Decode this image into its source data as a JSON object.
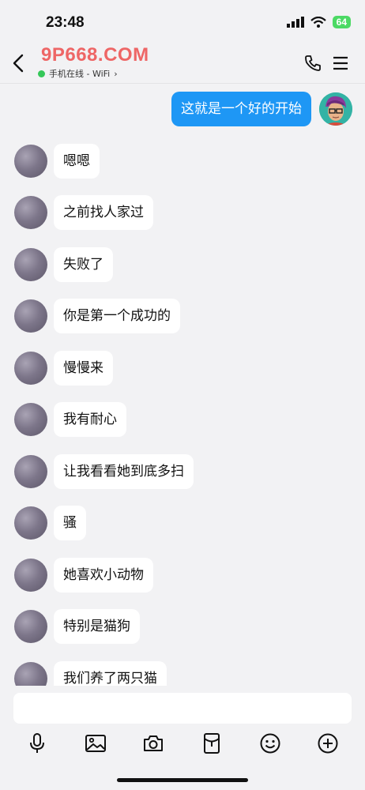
{
  "status": {
    "time": "23:48",
    "battery": "64"
  },
  "header": {
    "title": "9P668.COM",
    "status_text": "手机在线 - WiFi",
    "status_chevron": "›"
  },
  "sent_messages": [
    "这就是一个好的开始"
  ],
  "received_messages": [
    "嗯嗯",
    "之前找人家过",
    "失败了",
    "你是第一个成功的",
    "慢慢来",
    "我有耐心",
    "让我看看她到底多扫",
    "骚",
    "她喜欢小动物",
    "特别是猫狗",
    "我们养了两只猫"
  ],
  "input": {
    "value": "",
    "placeholder": ""
  },
  "toolbar_icons": [
    "microphone-icon",
    "image-icon",
    "camera-icon",
    "red-packet-icon",
    "emoji-icon",
    "plus-icon"
  ],
  "colors": {
    "sent_bubble": "#1e97f5",
    "online_dot": "#35c759",
    "title": "#e66666",
    "background": "#f2f2f4"
  }
}
